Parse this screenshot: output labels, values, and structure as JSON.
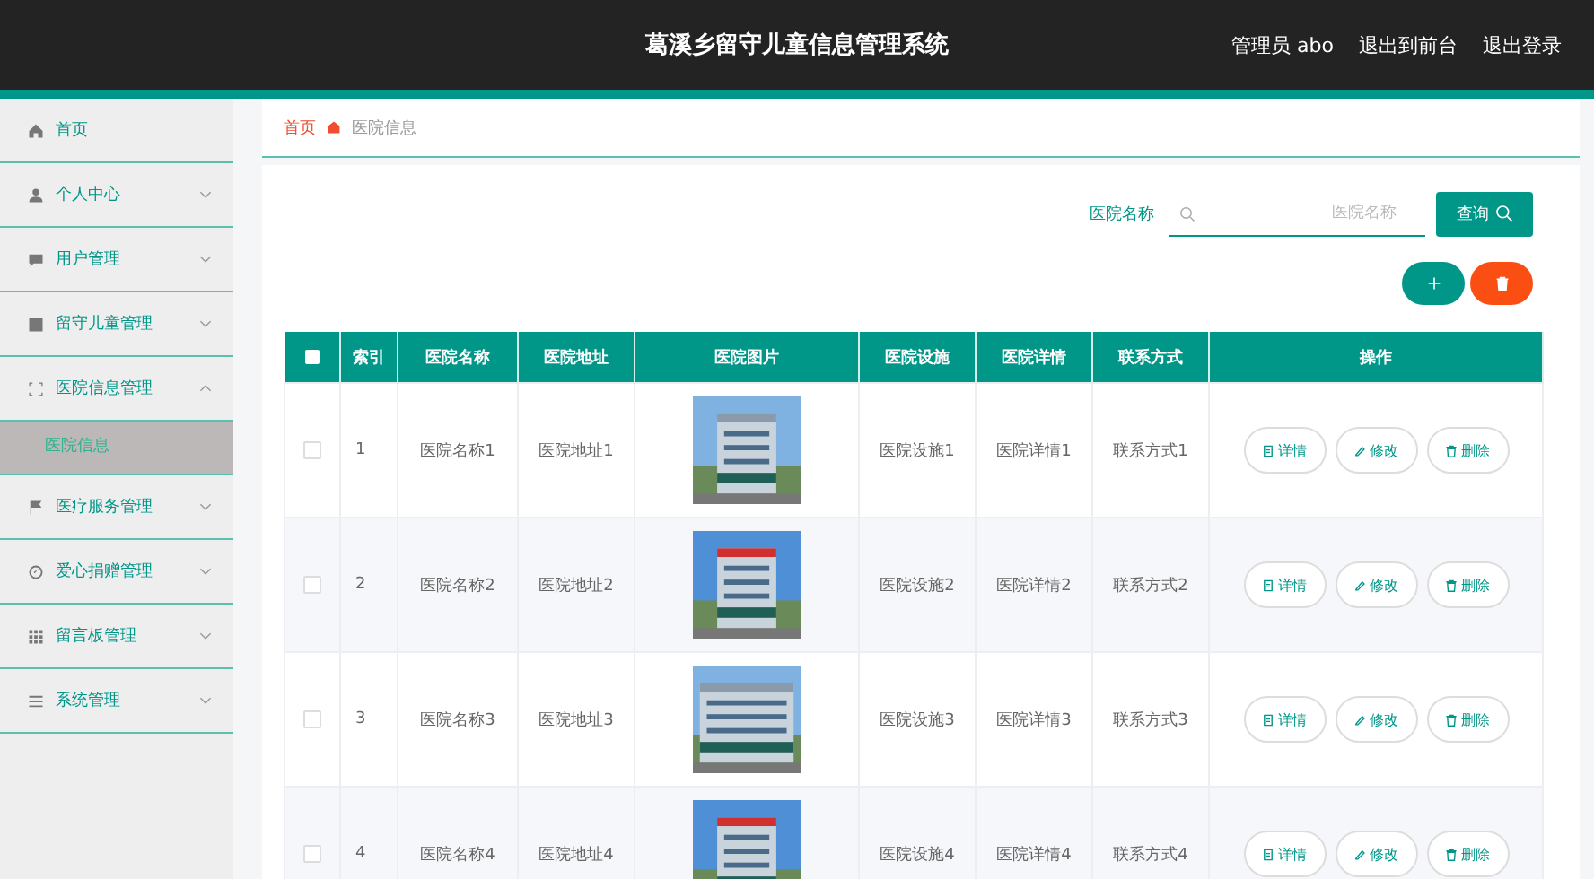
{
  "header": {
    "title": "葛溪乡留守儿童信息管理系统",
    "user": "管理员 abo",
    "links": [
      "退出到前台",
      "退出登录"
    ]
  },
  "sidebar": {
    "items": [
      {
        "label": "首页",
        "selected": false
      },
      {
        "label": "个人中心",
        "selected": false,
        "expanded": false
      },
      {
        "label": "用户管理",
        "selected": false,
        "expanded": false
      },
      {
        "label": "留守儿童管理",
        "selected": false,
        "expanded": false
      },
      {
        "label": "医院信息管理",
        "selected": false,
        "expanded": true,
        "children": [
          {
            "label": "医院信息",
            "selected": true
          }
        ]
      },
      {
        "label": "医疗服务管理",
        "selected": false,
        "expanded": false
      },
      {
        "label": "爱心捐赠管理",
        "selected": false,
        "expanded": false
      },
      {
        "label": "留言板管理",
        "selected": false,
        "expanded": false
      },
      {
        "label": "系统管理",
        "selected": false,
        "expanded": false
      }
    ]
  },
  "breadcrumb": [
    "首页",
    "医院信息"
  ],
  "search": {
    "label": "医院名称",
    "placeholder": "医院名称",
    "button": "查询"
  },
  "table": {
    "select_all": {
      "checked": false
    },
    "columns": [
      "索引",
      "医院名称",
      "医院地址",
      "医院图片",
      "医院设施",
      "医院详情",
      "联系方式",
      "操作"
    ],
    "rows": [
      {
        "selected": false,
        "index": "1",
        "name": "医院名称1",
        "address": "医院地址1",
        "facilities": "医院设施1",
        "details": "医院详情1",
        "contact": "联系方式1",
        "actions": [
          "详情",
          "修改",
          "删除"
        ]
      },
      {
        "selected": false,
        "index": "2",
        "name": "医院名称2",
        "address": "医院地址2",
        "facilities": "医院设施2",
        "details": "医院详情2",
        "contact": "联系方式2",
        "actions": [
          "详情",
          "修改",
          "删除"
        ]
      },
      {
        "selected": false,
        "index": "3",
        "name": "医院名称3",
        "address": "医院地址3",
        "facilities": "医院设施3",
        "details": "医院详情3",
        "contact": "联系方式3",
        "actions": [
          "详情",
          "修改",
          "删除"
        ]
      },
      {
        "selected": false,
        "index": "4",
        "name": "医院名称4",
        "address": "医院地址4",
        "facilities": "医院设施4",
        "details": "医院详情4",
        "contact": "联系方式4",
        "actions": [
          "详情",
          "修改",
          "删除"
        ]
      }
    ]
  }
}
